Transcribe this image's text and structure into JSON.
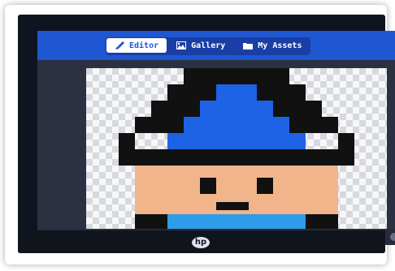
{
  "app": {
    "tabs": [
      {
        "label": "Editor",
        "icon": "brush-icon",
        "active": true
      },
      {
        "label": "Gallery",
        "icon": "image-icon",
        "active": false
      },
      {
        "label": "My Assets",
        "icon": "folder-icon",
        "active": false
      }
    ]
  },
  "device": {
    "brand": "hp"
  },
  "colors": {
    "topbar": "#1f57d3",
    "hat_blue": "#1e63e6",
    "skin": "#f2b48a",
    "hair": "#111111",
    "shirt_blue": "#2e9ce8",
    "pants_gray": "#a6a1aa",
    "belt_yellow": "#f2e35a"
  }
}
